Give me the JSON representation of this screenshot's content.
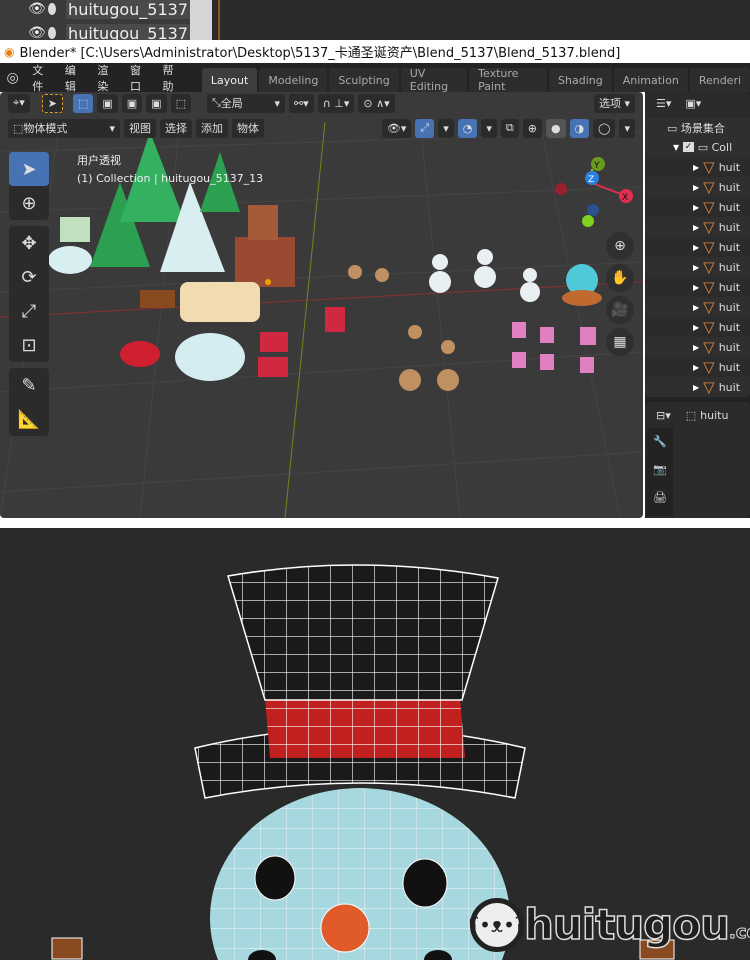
{
  "top_crop": {
    "rows": [
      "huitugou_5137",
      "huitugou_5137"
    ]
  },
  "titlebar": {
    "title": "Blender* [C:\\Users\\Administrator\\Desktop\\5137_卡通圣诞资产\\Blend_5137\\Blend_5137.blend]"
  },
  "menu": {
    "items": [
      "文件",
      "编辑",
      "渲染",
      "窗口",
      "帮助"
    ]
  },
  "workspace_tabs": [
    "Layout",
    "Modeling",
    "Sculpting",
    "UV Editing",
    "Texture Paint",
    "Shading",
    "Animation",
    "Renderi"
  ],
  "viewport": {
    "header": {
      "transform_orientation": "全局",
      "options": "选项",
      "mode": "物体模式",
      "view": "视图",
      "select": "选择",
      "add": "添加",
      "object": "物体"
    },
    "overlay_title": "用户透视",
    "overlay_info": "(1) Collection | huitugou_5137_13",
    "gizmo_axes": [
      "Y",
      "Z",
      "X"
    ]
  },
  "outliner": {
    "scene_collection": "场景集合",
    "collection": "Coll",
    "items": [
      "huit",
      "huit",
      "huit",
      "huit",
      "huit",
      "huit",
      "huit",
      "huit",
      "huit",
      "huit",
      "huit",
      "huit"
    ]
  },
  "properties": {
    "object_name": "huitu"
  },
  "watermark": {
    "brand": "huitugou",
    ".com": ".com"
  }
}
